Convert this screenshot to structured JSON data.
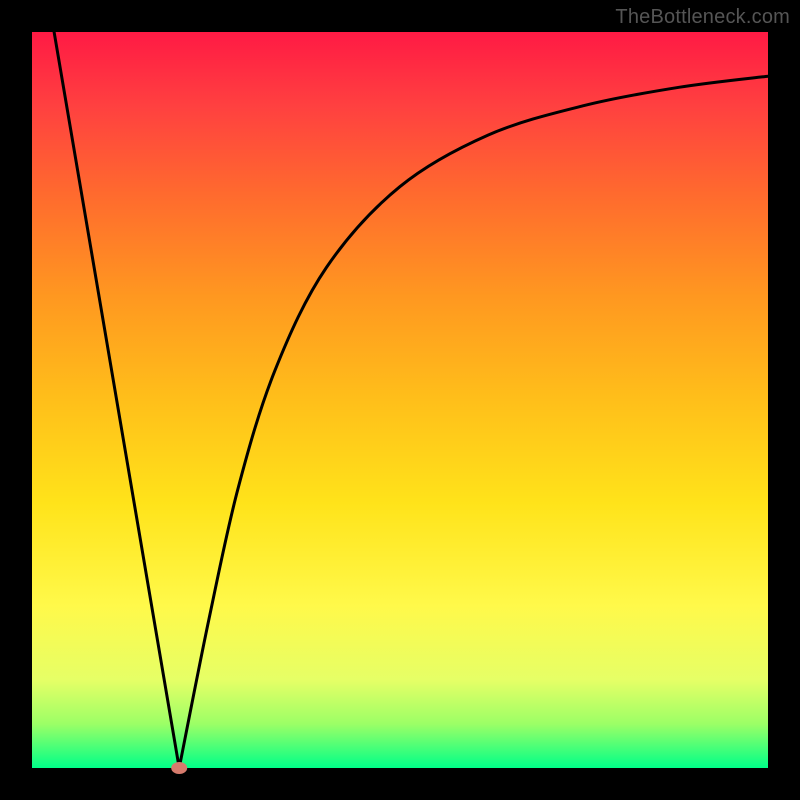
{
  "attribution": "TheBottleneck.com",
  "chart_data": {
    "type": "line",
    "title": "",
    "xlabel": "",
    "ylabel": "",
    "xlim": [
      0,
      100
    ],
    "ylim": [
      0,
      100
    ],
    "background_gradient": {
      "top": "#ff1a44",
      "bottom": "#00ff88"
    },
    "curve": {
      "description": "V-shaped curve: steep linear descent from upper-left to a minimum near x≈20, then an asymptotic rise toward the upper-right",
      "min_point": {
        "x": 20,
        "y": 0
      },
      "points": [
        {
          "x": 3,
          "y": 100
        },
        {
          "x": 20,
          "y": 0
        },
        {
          "x": 24,
          "y": 20
        },
        {
          "x": 28,
          "y": 38
        },
        {
          "x": 33,
          "y": 54
        },
        {
          "x": 40,
          "y": 68
        },
        {
          "x": 50,
          "y": 79
        },
        {
          "x": 62,
          "y": 86
        },
        {
          "x": 75,
          "y": 90
        },
        {
          "x": 88,
          "y": 92.5
        },
        {
          "x": 100,
          "y": 94
        }
      ]
    },
    "marker": {
      "x": 20,
      "y": 0,
      "color": "#d67b6d"
    }
  }
}
